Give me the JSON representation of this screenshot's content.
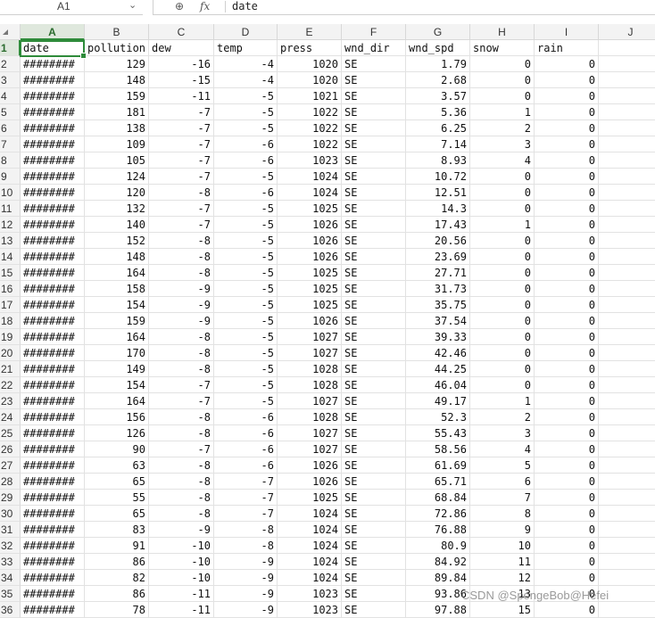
{
  "formula_bar": {
    "name_box": "A1",
    "fx_label": "fx",
    "value": "date"
  },
  "columns": [
    "A",
    "B",
    "C",
    "D",
    "E",
    "F",
    "G",
    "H",
    "I",
    "J"
  ],
  "header_row": [
    "date",
    "pollution",
    "dew",
    "temp",
    "press",
    "wnd_dir",
    "wnd_spd",
    "snow",
    "rain",
    ""
  ],
  "rows": [
    {
      "n": "2",
      "cells": [
        "########",
        "129",
        "-16",
        "-4",
        "1020",
        "SE",
        "1.79",
        "0",
        "0"
      ]
    },
    {
      "n": "3",
      "cells": [
        "########",
        "148",
        "-15",
        "-4",
        "1020",
        "SE",
        "2.68",
        "0",
        "0"
      ]
    },
    {
      "n": "4",
      "cells": [
        "########",
        "159",
        "-11",
        "-5",
        "1021",
        "SE",
        "3.57",
        "0",
        "0"
      ]
    },
    {
      "n": "5",
      "cells": [
        "########",
        "181",
        "-7",
        "-5",
        "1022",
        "SE",
        "5.36",
        "1",
        "0"
      ]
    },
    {
      "n": "6",
      "cells": [
        "########",
        "138",
        "-7",
        "-5",
        "1022",
        "SE",
        "6.25",
        "2",
        "0"
      ]
    },
    {
      "n": "7",
      "cells": [
        "########",
        "109",
        "-7",
        "-6",
        "1022",
        "SE",
        "7.14",
        "3",
        "0"
      ]
    },
    {
      "n": "8",
      "cells": [
        "########",
        "105",
        "-7",
        "-6",
        "1023",
        "SE",
        "8.93",
        "4",
        "0"
      ]
    },
    {
      "n": "9",
      "cells": [
        "########",
        "124",
        "-7",
        "-5",
        "1024",
        "SE",
        "10.72",
        "0",
        "0"
      ]
    },
    {
      "n": "10",
      "cells": [
        "########",
        "120",
        "-8",
        "-6",
        "1024",
        "SE",
        "12.51",
        "0",
        "0"
      ]
    },
    {
      "n": "11",
      "cells": [
        "########",
        "132",
        "-7",
        "-5",
        "1025",
        "SE",
        "14.3",
        "0",
        "0"
      ]
    },
    {
      "n": "12",
      "cells": [
        "########",
        "140",
        "-7",
        "-5",
        "1026",
        "SE",
        "17.43",
        "1",
        "0"
      ]
    },
    {
      "n": "13",
      "cells": [
        "########",
        "152",
        "-8",
        "-5",
        "1026",
        "SE",
        "20.56",
        "0",
        "0"
      ]
    },
    {
      "n": "14",
      "cells": [
        "########",
        "148",
        "-8",
        "-5",
        "1026",
        "SE",
        "23.69",
        "0",
        "0"
      ]
    },
    {
      "n": "15",
      "cells": [
        "########",
        "164",
        "-8",
        "-5",
        "1025",
        "SE",
        "27.71",
        "0",
        "0"
      ]
    },
    {
      "n": "16",
      "cells": [
        "########",
        "158",
        "-9",
        "-5",
        "1025",
        "SE",
        "31.73",
        "0",
        "0"
      ]
    },
    {
      "n": "17",
      "cells": [
        "########",
        "154",
        "-9",
        "-5",
        "1025",
        "SE",
        "35.75",
        "0",
        "0"
      ]
    },
    {
      "n": "18",
      "cells": [
        "########",
        "159",
        "-9",
        "-5",
        "1026",
        "SE",
        "37.54",
        "0",
        "0"
      ]
    },
    {
      "n": "19",
      "cells": [
        "########",
        "164",
        "-8",
        "-5",
        "1027",
        "SE",
        "39.33",
        "0",
        "0"
      ]
    },
    {
      "n": "20",
      "cells": [
        "########",
        "170",
        "-8",
        "-5",
        "1027",
        "SE",
        "42.46",
        "0",
        "0"
      ]
    },
    {
      "n": "21",
      "cells": [
        "########",
        "149",
        "-8",
        "-5",
        "1028",
        "SE",
        "44.25",
        "0",
        "0"
      ]
    },
    {
      "n": "22",
      "cells": [
        "########",
        "154",
        "-7",
        "-5",
        "1028",
        "SE",
        "46.04",
        "0",
        "0"
      ]
    },
    {
      "n": "23",
      "cells": [
        "########",
        "164",
        "-7",
        "-5",
        "1027",
        "SE",
        "49.17",
        "1",
        "0"
      ]
    },
    {
      "n": "24",
      "cells": [
        "########",
        "156",
        "-8",
        "-6",
        "1028",
        "SE",
        "52.3",
        "2",
        "0"
      ]
    },
    {
      "n": "25",
      "cells": [
        "########",
        "126",
        "-8",
        "-6",
        "1027",
        "SE",
        "55.43",
        "3",
        "0"
      ]
    },
    {
      "n": "26",
      "cells": [
        "########",
        "90",
        "-7",
        "-6",
        "1027",
        "SE",
        "58.56",
        "4",
        "0"
      ]
    },
    {
      "n": "27",
      "cells": [
        "########",
        "63",
        "-8",
        "-6",
        "1026",
        "SE",
        "61.69",
        "5",
        "0"
      ]
    },
    {
      "n": "28",
      "cells": [
        "########",
        "65",
        "-8",
        "-7",
        "1026",
        "SE",
        "65.71",
        "6",
        "0"
      ]
    },
    {
      "n": "29",
      "cells": [
        "########",
        "55",
        "-8",
        "-7",
        "1025",
        "SE",
        "68.84",
        "7",
        "0"
      ]
    },
    {
      "n": "30",
      "cells": [
        "########",
        "65",
        "-8",
        "-7",
        "1024",
        "SE",
        "72.86",
        "8",
        "0"
      ]
    },
    {
      "n": "31",
      "cells": [
        "########",
        "83",
        "-9",
        "-8",
        "1024",
        "SE",
        "76.88",
        "9",
        "0"
      ]
    },
    {
      "n": "32",
      "cells": [
        "########",
        "91",
        "-10",
        "-8",
        "1024",
        "SE",
        "80.9",
        "10",
        "0"
      ]
    },
    {
      "n": "33",
      "cells": [
        "########",
        "86",
        "-10",
        "-9",
        "1024",
        "SE",
        "84.92",
        "11",
        "0"
      ]
    },
    {
      "n": "34",
      "cells": [
        "########",
        "82",
        "-10",
        "-9",
        "1024",
        "SE",
        "89.84",
        "12",
        "0"
      ]
    },
    {
      "n": "35",
      "cells": [
        "########",
        "86",
        "-11",
        "-9",
        "1023",
        "SE",
        "93.86",
        "13",
        "0"
      ]
    },
    {
      "n": "36",
      "cells": [
        "########",
        "78",
        "-11",
        "-9",
        "1023",
        "SE",
        "97.88",
        "15",
        "0"
      ]
    }
  ],
  "watermark": "CSDN @SpongeBob@Hefei"
}
